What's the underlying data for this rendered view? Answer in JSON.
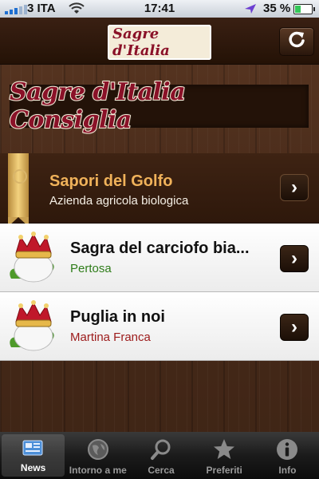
{
  "status": {
    "carrier": "3 ITA",
    "time": "17:41",
    "battery_pct": "35 %",
    "battery_level": 0.35
  },
  "header": {
    "logo_text": "Sagre d'Italia"
  },
  "banner": {
    "text": "Sagre d'Italia Consiglia"
  },
  "featured": {
    "title": "Sapori del Golfo",
    "subtitle": "Azienda agricola biologica"
  },
  "events": [
    {
      "title": "Sagra del carciofo bia...",
      "location": "Pertosa",
      "color": "#2f7d1a"
    },
    {
      "title": "Puglia in noi",
      "location": "Martina Franca",
      "color": "#9c1a1a"
    }
  ],
  "tabs": [
    {
      "label": "News",
      "icon": "news-icon"
    },
    {
      "label": "Intorno a me",
      "icon": "globe-icon"
    },
    {
      "label": "Cerca",
      "icon": "search-icon"
    },
    {
      "label": "Preferiti",
      "icon": "star-icon"
    },
    {
      "label": "Info",
      "icon": "info-icon"
    }
  ]
}
